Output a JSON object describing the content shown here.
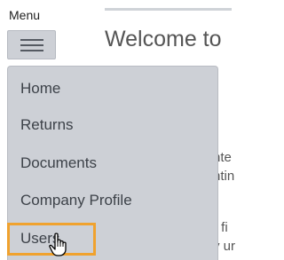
{
  "header": {
    "menu_label": "Menu",
    "welcome_text": "Welcome to"
  },
  "background_text": [
    "nte",
    "ntin",
    "r fi",
    "y ur"
  ],
  "dropdown": {
    "items": [
      {
        "label": "Home"
      },
      {
        "label": "Returns"
      },
      {
        "label": "Documents"
      },
      {
        "label": "Company Profile"
      },
      {
        "label": "Users"
      }
    ],
    "hovered_item": "Users"
  },
  "icons": {
    "menu_toggle": "hamburger-icon",
    "cursor": "hand-pointer-icon"
  },
  "colors": {
    "dropdown_bg": "#cdd0d6",
    "highlight": "#f0a22e",
    "text": "#3d4249"
  }
}
